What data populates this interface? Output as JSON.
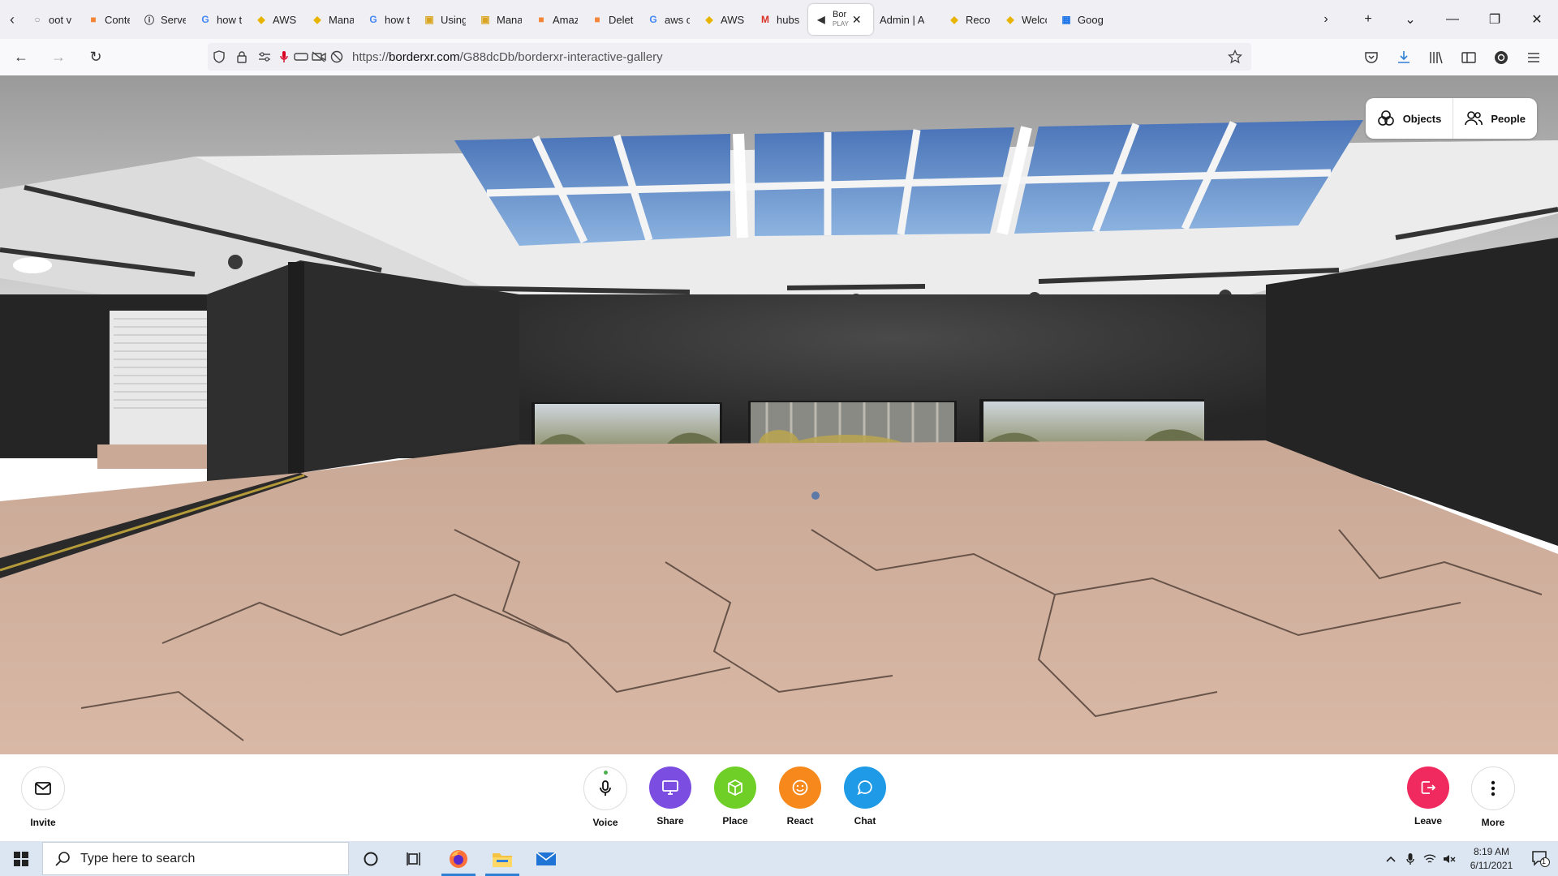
{
  "tabs": [
    {
      "label": "oot v",
      "icon": "generic-icon",
      "color": "#888888"
    },
    {
      "label": "Conte",
      "icon": "aws-box-icon",
      "color": "#f58536"
    },
    {
      "label": "Server",
      "icon": "info-icon",
      "color": "#333333"
    },
    {
      "label": "how t",
      "icon": "google-icon",
      "color": "#4285f4"
    },
    {
      "label": "AWS T",
      "icon": "duck-icon",
      "color": "#e8b400"
    },
    {
      "label": "Mana",
      "icon": "duck-icon",
      "color": "#e8b400"
    },
    {
      "label": "how t",
      "icon": "google-icon",
      "color": "#4285f4"
    },
    {
      "label": "Using",
      "icon": "box-icon",
      "color": "#d9a520"
    },
    {
      "label": "Mana",
      "icon": "box-icon",
      "color": "#d9a520"
    },
    {
      "label": "Amaz",
      "icon": "aws-box-icon",
      "color": "#f58536"
    },
    {
      "label": "Delete",
      "icon": "aws-box-icon",
      "color": "#f58536"
    },
    {
      "label": "aws c",
      "icon": "google-icon",
      "color": "#4285f4"
    },
    {
      "label": "AWS T",
      "icon": "duck-icon",
      "color": "#e8b400"
    },
    {
      "label": "hubs",
      "icon": "gmail-icon",
      "color": "#d93025"
    }
  ],
  "active_tab": {
    "label_top": "Bor",
    "label_bottom": "PLAY",
    "icon": "speaker-icon"
  },
  "tabs_after": [
    {
      "label": "Admin | A",
      "icon": "none",
      "color": "#333333"
    },
    {
      "label": "Recor",
      "icon": "duck-icon",
      "color": "#e8b400"
    },
    {
      "label": "Welco",
      "icon": "duck-icon",
      "color": "#e8b400"
    },
    {
      "label": "Googl",
      "icon": "calendar-icon",
      "color": "#1a73e8"
    }
  ],
  "url": {
    "prefix": "https://",
    "domain": "borderxr.com",
    "path": "/G88dcDb/borderxr-interactive-gallery"
  },
  "scene_buttons": {
    "objects": "Objects",
    "people": "People"
  },
  "toolbar": {
    "invite": "Invite",
    "voice": "Voice",
    "share": "Share",
    "place": "Place",
    "react": "React",
    "chat": "Chat",
    "leave": "Leave",
    "more": "More"
  },
  "colors": {
    "share": "#7b4de0",
    "place": "#6fcf26",
    "react": "#f7891c",
    "chat": "#1f9ae6",
    "leave": "#f0295e"
  },
  "taskbar": {
    "search_placeholder": "Type here to search",
    "time": "8:19 AM",
    "date": "6/11/2021",
    "notification_count": "1"
  }
}
